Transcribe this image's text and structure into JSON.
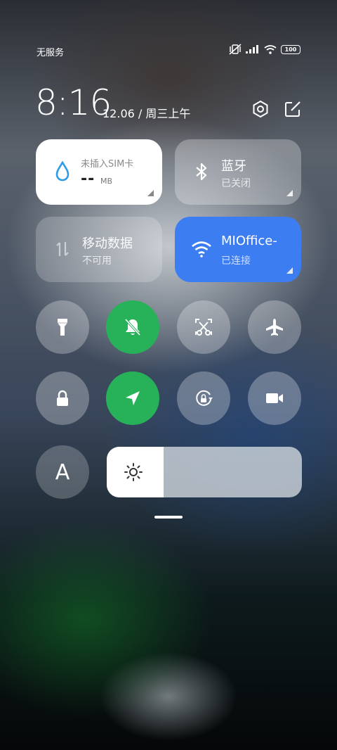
{
  "status_bar": {
    "carrier": "无服务",
    "battery": "100"
  },
  "header": {
    "time": "8:16",
    "date": "12.06 / 周三上午"
  },
  "tiles": {
    "data": {
      "title": "未插入SIM卡",
      "value": "--",
      "unit": "MB"
    },
    "bluetooth": {
      "title": "蓝牙",
      "subtitle": "已关闭"
    },
    "mobile_data": {
      "title": "移动数据",
      "subtitle": "不可用"
    },
    "wifi": {
      "title": "MIOffice-",
      "subtitle": "已连接"
    }
  },
  "toggles": {
    "flashlight": {
      "icon": "flashlight-icon",
      "state": "off"
    },
    "silent": {
      "icon": "bell-off-icon",
      "state": "on"
    },
    "screenshot": {
      "icon": "scissors-icon",
      "state": "off"
    },
    "airplane": {
      "icon": "airplane-icon",
      "state": "off"
    },
    "lock": {
      "icon": "lock-icon",
      "state": "off"
    },
    "location": {
      "icon": "location-arrow-icon",
      "state": "on"
    },
    "rotation_lock": {
      "icon": "rotation-lock-icon",
      "state": "off"
    },
    "screen_record": {
      "icon": "video-camera-icon",
      "state": "off"
    }
  },
  "auto_brightness": {
    "label": "A"
  },
  "brightness": {
    "level": 0.29
  },
  "colors": {
    "accent": "#3d7df2",
    "active": "#27b25a",
    "data_drop": "#2f9be6"
  }
}
